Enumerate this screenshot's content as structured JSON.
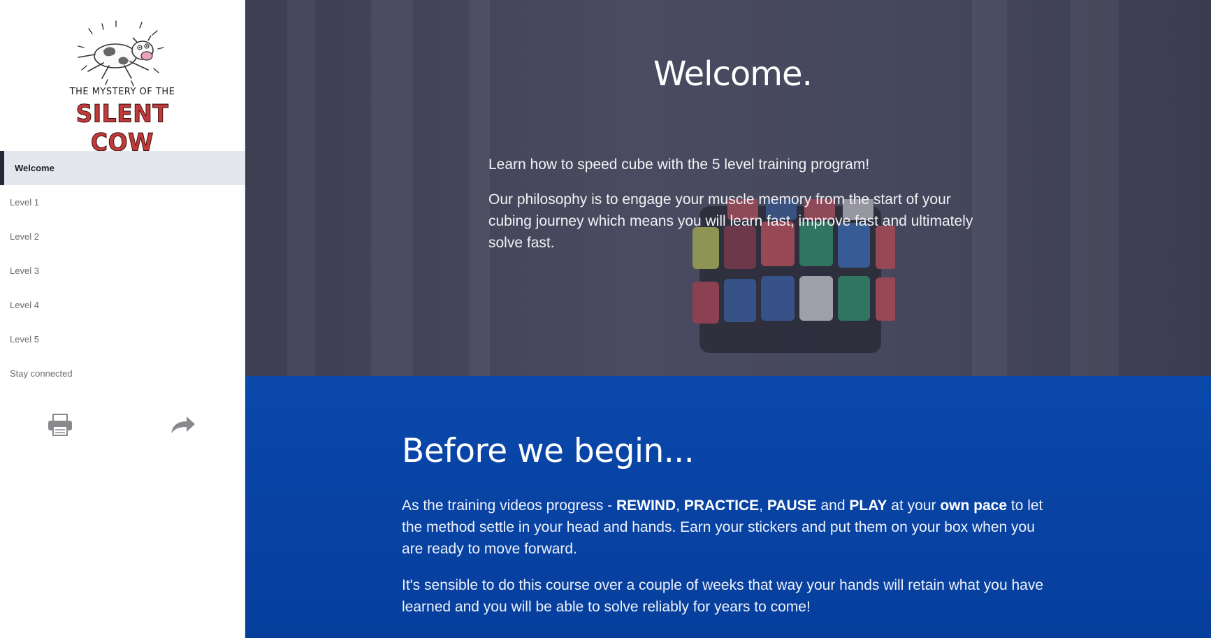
{
  "logo": {
    "top_line": "THE MYSTERY OF THE",
    "main_line": "SILENT COW"
  },
  "nav": {
    "items": [
      {
        "label": "Welcome",
        "active": true
      },
      {
        "label": "Level 1",
        "active": false
      },
      {
        "label": "Level 2",
        "active": false
      },
      {
        "label": "Level 3",
        "active": false
      },
      {
        "label": "Level 4",
        "active": false
      },
      {
        "label": "Level 5",
        "active": false
      },
      {
        "label": "Stay connected",
        "active": false
      }
    ]
  },
  "tools": {
    "print_icon": "printer-icon",
    "share_icon": "share-arrow-icon"
  },
  "hero": {
    "title": "Welcome.",
    "paragraph1": "Learn how to speed cube with the 5 level training program!",
    "paragraph2": "Our philosophy is to engage your muscle memory from the start of your cubing journey which means you will learn fast, improve fast and ultimately solve fast."
  },
  "intro": {
    "title": "Before we begin...",
    "p1_a": "As the training videos progress - ",
    "p1_rewind": "REWIND",
    "p1_comma1": ", ",
    "p1_practice": "PRACTICE",
    "p1_comma2": ", ",
    "p1_pause": "PAUSE",
    "p1_and": " and ",
    "p1_play": "PLAY",
    "p1_at": " at your ",
    "p1_ownpace": "own pace",
    "p1_rest": " to let the method settle in your head and hands. Earn your stickers and put them on your box when you are ready to move forward.",
    "p2": "It's sensible to do this course over a couple of weeks that way your hands will retain what you have learned and you will be able to solve reliably for years to come!"
  },
  "colors": {
    "blue_section": "#0a48ab",
    "hero_overlay": "#44465b",
    "active_nav_bg": "#e5e7ef",
    "active_nav_bar": "#252a3a",
    "logo_red": "#c23a3a"
  }
}
